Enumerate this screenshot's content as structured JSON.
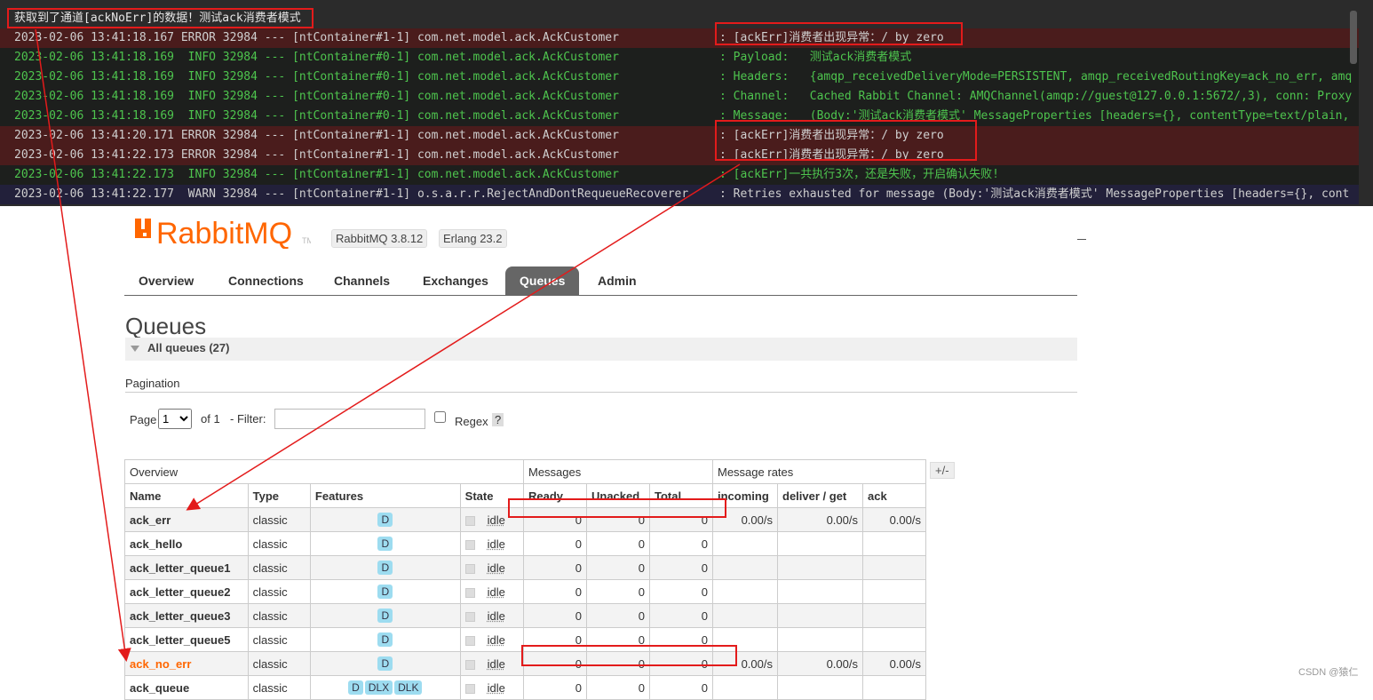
{
  "console": {
    "first_line": "获取到了通道[ackNoErr]的数据！测试ack消费者模式",
    "lines": [
      {
        "kind": "err",
        "left": "2023-02-06 13:41:18.167 ERROR 32984 --- [ntContainer#1-1] com.net.model.ack.AckCustomer",
        "right": ": [ackErr]消费者出现异常：/ by zero"
      },
      {
        "kind": "info",
        "left": "2023-02-06 13:41:18.169  INFO 32984 --- [ntContainer#0-1] com.net.model.ack.AckCustomer",
        "right": ": Payload:   测试ack消费者模式"
      },
      {
        "kind": "info",
        "left": "2023-02-06 13:41:18.169  INFO 32984 --- [ntContainer#0-1] com.net.model.ack.AckCustomer",
        "right": ": Headers:   {amqp_receivedDeliveryMode=PERSISTENT, amqp_receivedRoutingKey=ack_no_err, amq"
      },
      {
        "kind": "info",
        "left": "2023-02-06 13:41:18.169  INFO 32984 --- [ntContainer#0-1] com.net.model.ack.AckCustomer",
        "right": ": Channel:   Cached Rabbit Channel: AMQChannel(amqp://guest@127.0.0.1:5672/,3), conn: Proxy"
      },
      {
        "kind": "info",
        "left": "2023-02-06 13:41:18.169  INFO 32984 --- [ntContainer#0-1] com.net.model.ack.AckCustomer",
        "right": ": Message:   (Body:'测试ack消费者模式' MessageProperties [headers={}, contentType=text/plain, "
      },
      {
        "kind": "err",
        "left": "2023-02-06 13:41:20.171 ERROR 32984 --- [ntContainer#1-1] com.net.model.ack.AckCustomer",
        "right": ": [ackErr]消费者出现异常：/ by zero"
      },
      {
        "kind": "err",
        "left": "2023-02-06 13:41:22.173 ERROR 32984 --- [ntContainer#1-1] com.net.model.ack.AckCustomer",
        "right": ": [ackErr]消费者出现异常：/ by zero"
      },
      {
        "kind": "info",
        "left": "2023-02-06 13:41:22.173  INFO 32984 --- [ntContainer#1-1] com.net.model.ack.AckCustomer",
        "right": ": [ackErr]一共执行3次，还是失败，开启确认失败!"
      },
      {
        "kind": "warn",
        "left": "2023-02-06 13:41:22.177  WARN 32984 --- [ntContainer#1-1] o.s.a.r.r.RejectAndDontRequeueRecoverer",
        "right": ": Retries exhausted for message (Body:'测试ack消费者模式' MessageProperties [headers={}, cont"
      }
    ]
  },
  "rabbit": {
    "logo_text": "RabbitMQ",
    "logo_tm": "TM",
    "version": "RabbitMQ 3.8.12",
    "erlang": "Erlang 23.2",
    "tabs": [
      "Overview",
      "Connections",
      "Channels",
      "Exchanges",
      "Queues",
      "Admin"
    ],
    "active_tab": "Queues",
    "page_title": "Queues",
    "all_queues": "All queues (27)",
    "pagination_label": "Pagination",
    "page_label": "Page",
    "page_value": "1",
    "of_label": "of 1",
    "filter_label": "- Filter:",
    "regex_label": "Regex",
    "help": "?",
    "plus_minus": "+/-",
    "group_headers": [
      "Overview",
      "Messages",
      "Message rates"
    ],
    "columns": [
      "Name",
      "Type",
      "Features",
      "State",
      "Ready",
      "Unacked",
      "Total",
      "incoming",
      "deliver / get",
      "ack"
    ],
    "rows": [
      {
        "name": "ack_err",
        "type": "classic",
        "features": [
          "D"
        ],
        "state": "idle",
        "ready": "0",
        "unacked": "0",
        "total": "0",
        "incoming": "0.00/s",
        "deliver": "0.00/s",
        "ack": "0.00/s"
      },
      {
        "name": "ack_hello",
        "type": "classic",
        "features": [
          "D"
        ],
        "state": "idle",
        "ready": "0",
        "unacked": "0",
        "total": "0",
        "incoming": "",
        "deliver": "",
        "ack": ""
      },
      {
        "name": "ack_letter_queue1",
        "type": "classic",
        "features": [
          "D"
        ],
        "state": "idle",
        "ready": "0",
        "unacked": "0",
        "total": "0",
        "incoming": "",
        "deliver": "",
        "ack": ""
      },
      {
        "name": "ack_letter_queue2",
        "type": "classic",
        "features": [
          "D"
        ],
        "state": "idle",
        "ready": "0",
        "unacked": "0",
        "total": "0",
        "incoming": "",
        "deliver": "",
        "ack": ""
      },
      {
        "name": "ack_letter_queue3",
        "type": "classic",
        "features": [
          "D"
        ],
        "state": "idle",
        "ready": "0",
        "unacked": "0",
        "total": "0",
        "incoming": "",
        "deliver": "",
        "ack": ""
      },
      {
        "name": "ack_letter_queue5",
        "type": "classic",
        "features": [
          "D"
        ],
        "state": "idle",
        "ready": "0",
        "unacked": "0",
        "total": "0",
        "incoming": "",
        "deliver": "",
        "ack": ""
      },
      {
        "name": "ack_no_err",
        "type": "classic",
        "features": [
          "D"
        ],
        "state": "idle",
        "ready": "0",
        "unacked": "0",
        "total": "0",
        "incoming": "0.00/s",
        "deliver": "0.00/s",
        "ack": "0.00/s",
        "highlight": true
      },
      {
        "name": "ack_queue",
        "type": "classic",
        "features": [
          "D",
          "DLX",
          "DLK"
        ],
        "state": "idle",
        "ready": "0",
        "unacked": "0",
        "total": "0",
        "incoming": "",
        "deliver": "",
        "ack": ""
      }
    ]
  },
  "watermark": "CSDN @猿仁",
  "colors": {
    "accent": "#f60",
    "annotation": "#e31b1b"
  }
}
